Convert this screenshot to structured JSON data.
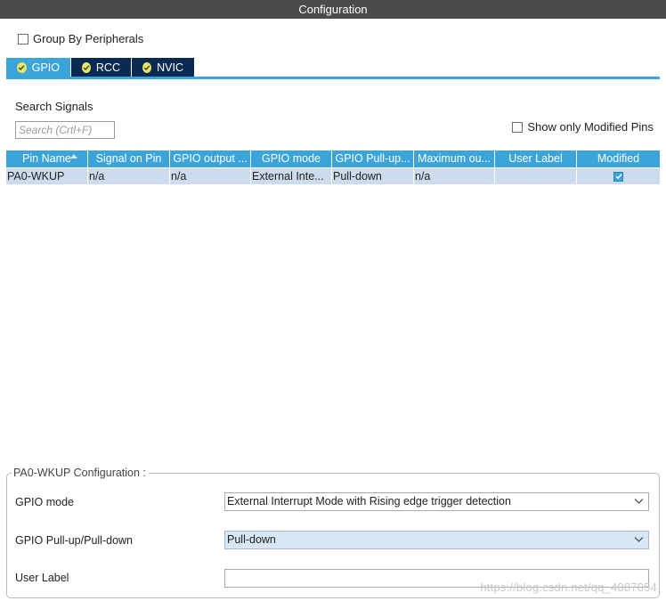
{
  "window": {
    "title": "Configuration"
  },
  "group_by": {
    "label": "Group By Peripherals",
    "checked": false
  },
  "tabs": [
    {
      "label": "GPIO",
      "active": true
    },
    {
      "label": "RCC",
      "active": false
    },
    {
      "label": "NVIC",
      "active": false
    }
  ],
  "search": {
    "label": "Search Signals",
    "placeholder": "Search (Crtl+F)",
    "value": ""
  },
  "show_modified": {
    "label": "Show only Modified Pins",
    "checked": false
  },
  "table": {
    "columns": [
      "Pin Name",
      "Signal on Pin",
      "GPIO output ...",
      "GPIO mode",
      "GPIO Pull-up...",
      "Maximum ou...",
      "User Label",
      "Modified"
    ],
    "sorted_by": "Pin Name",
    "rows": [
      {
        "pin_name": "PA0-WKUP",
        "signal": "n/a",
        "gpio_output": "n/a",
        "gpio_mode": "External Inte...",
        "pull": "Pull-down",
        "max_output": "n/a",
        "user_label": "",
        "modified": true
      }
    ]
  },
  "config": {
    "legend": "PA0-WKUP Configuration :",
    "gpio_mode_label": "GPIO mode",
    "gpio_mode_value": "External Interrupt Mode with Rising edge trigger detection",
    "pull_label": "GPIO Pull-up/Pull-down",
    "pull_value": "Pull-down",
    "user_label_label": "User Label",
    "user_label_value": ""
  },
  "watermark": "https://blog.csdn.net/qq_4087054",
  "colors": {
    "accent": "#3ba4d9",
    "tab_inactive": "#0b2a52",
    "titlebar": "#4b4b4b",
    "row_selected": "#cddcec",
    "tab_check": "#e9e56a"
  }
}
